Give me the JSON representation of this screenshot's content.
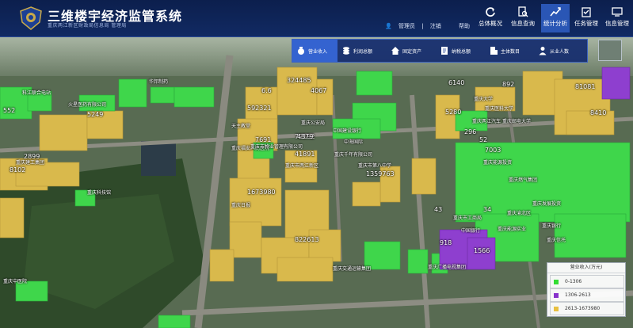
{
  "app": {
    "title": "三维楼宇经济监管系统",
    "subtitle": "重庆两江新区财政局信息局 管理局"
  },
  "user": {
    "name": "管理员",
    "logout": "注销",
    "help": "帮助"
  },
  "nav": [
    {
      "label": "总体概况",
      "icon": "refresh-icon"
    },
    {
      "label": "信息查询",
      "icon": "document-search-icon"
    },
    {
      "label": "统计分析",
      "icon": "chart-icon"
    },
    {
      "label": "任务管理",
      "icon": "clipboard-check-icon"
    },
    {
      "label": "信息管理",
      "icon": "monitor-icon"
    }
  ],
  "toolbar": [
    {
      "label": "营业收入",
      "icon": "money-bag-icon"
    },
    {
      "label": "利润总额",
      "icon": "coins-icon"
    },
    {
      "label": "固定资产",
      "icon": "house-icon"
    },
    {
      "label": "纳税总额",
      "icon": "tax-form-icon"
    },
    {
      "label": "主体数目",
      "icon": "building-icon"
    },
    {
      "label": "从业人数",
      "icon": "person-icon"
    }
  ],
  "legend": {
    "title": "营业收入(万元)",
    "items": [
      {
        "label": "0-1306",
        "color": "#33dd33"
      },
      {
        "label": "1306-2613",
        "color": "#8833cc"
      },
      {
        "label": "2613-1673980",
        "color": "#e8c040"
      }
    ]
  },
  "map": {
    "value_labels": [
      "324485",
      "592321",
      "7691",
      "79192",
      "1359763",
      "4379",
      "41891",
      "5249",
      "1673980",
      "822613",
      "918",
      "1566",
      "6140",
      "5280",
      "296",
      "892",
      "52",
      "8410",
      "81081",
      "43",
      "34",
      "6.6",
      "4067",
      "2899",
      "8102",
      "552",
      "7003"
    ],
    "place_labels": [
      "科江联合电站",
      "华邦制药",
      "火星医药有限公司",
      "天主教堂",
      "重庆福安人民医院",
      "重庆市物业管理有限公司",
      "中国建设银行",
      "重庆千年有限公司",
      "重庆日报",
      "重庆市第八中学",
      "重庆市两江新区",
      "中海国际",
      "重庆大学",
      "重庆交通运输集团",
      "重庆广播电视集团",
      "重庆医科大学",
      "重庆邮电大学",
      "重庆市工商局",
      "重庆渝北区",
      "中国银行",
      "重庆银行",
      "重庆信托",
      "重庆科技馆",
      "重庆中医院",
      "重庆公安局",
      "重庆两江汽车",
      "重庆能源投资",
      "重庆发展投资",
      "重庆能源实业",
      "重庆燃气集团",
      "重庆建工集团"
    ]
  }
}
